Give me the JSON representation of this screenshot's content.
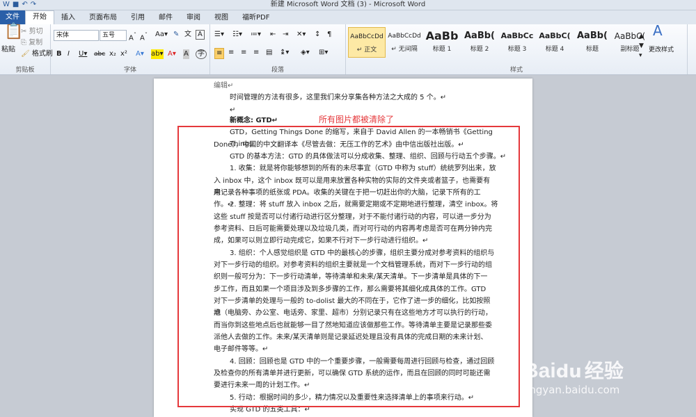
{
  "window": {
    "title": "新建 Microsoft Word 文档 (3)  -  Microsoft Word"
  },
  "tabs": [
    "文件",
    "开始",
    "插入",
    "页面布局",
    "引用",
    "邮件",
    "审阅",
    "视图",
    "福昕PDF"
  ],
  "clipboard": {
    "paste": "粘贴",
    "cut": "剪切",
    "copy": "复制",
    "format_painter": "格式刷",
    "label": "剪贴板"
  },
  "font": {
    "name": "宋体",
    "size": "五号",
    "label": "字体"
  },
  "paragraph": {
    "label": "段落"
  },
  "styles": {
    "label": "样式",
    "items": [
      {
        "sample": "AaBbCcDd",
        "name": "↵ 正文"
      },
      {
        "sample": "AaBbCcDd",
        "name": "↵ 无间隔"
      },
      {
        "sample": "AaBb",
        "name": "标题 1"
      },
      {
        "sample": "AaBb(",
        "name": "标题 2"
      },
      {
        "sample": "AaBbCc",
        "name": "标题 3"
      },
      {
        "sample": "AaBbC(",
        "name": "标题 4"
      },
      {
        "sample": "AaBb(",
        "name": "标题"
      },
      {
        "sample": "AaBbC(",
        "name": "副标题"
      }
    ],
    "change_styles": "更改样式"
  },
  "document": {
    "lines": [
      "编辑↵",
      "时间管理的方法有很多，这里我们来分享集各种方法之大成的 5 个。↵",
      "↵",
      "新概念: GTD↵",
      "GTD，Getting Things Done 的缩写，来自于 David Allen 的一本畅销书《Getting Things",
      "Done》，中国的中文翻译本《尽管去做：无压工作的艺术》由中信出版社出版。↵",
      "GTD 的基本方法：GTD 的具体做法可以分成收集、整理、组织、回顾与行动五个步骤。↵",
      "1. 收集：就是将你能够想到的所有的未尽事宜（GTD 中称为 stuff）统统罗列出来，放",
      "入 inbox 中，这个 inbox 既可以是用来放置各种实物的实际的文件夹或者篮子，也需要有用",
      "来记录各种事项的纸张或 PDA。收集的关键在于把一切赶出你的大脑，记录下所有的工作。↵",
      "2. 整理：将 stuff 放入 inbox 之后，就需要定期或不定期地进行整理，清空 inbox。将",
      "这些 stuff 按是否可以付诸行动进行区分整理，对于不能付诸行动的内容，可以进一步分为",
      "参考资料、日后可能需要处理以及垃圾几类，而对可行动的内容再考虑是否可在两分钟内完",
      "成，如果可以则立即行动完成它，如果不行对下一步行动进行组织。↵",
      "3. 组织：个人感觉组织是 GTD 中的最核心的步骤，组织主要分成对参考资料的组织与",
      "对下一步行动的组织。对参考资料的组织主要就是一个文档管理系统，而对下一步行动的组",
      "织则一般可分为：下一步行动清单，等待清单和未来/某天清单。下一步清单是具体的下一",
      "步工作，而且如果一个项目涉及到多步骤的工作，那么需要将其细化成具体的工作。GTD",
      "对下一步清单的处理与一般的 to-dolist 最大的不同在于，它作了进一步的细化，比如按照地",
      "点（电脑旁、办公室、电话旁、家里、超市）分别记录只有在这些地方才可以执行的行动，",
      "而当你到这些地点后也就能够一目了然地知道应该做那些工作。等待清单主要是记录那些委",
      "派他人去做的工作。未来/某天清单则是记录延迟处理且没有具体的完成日期的未来计划、",
      "电子邮件等等。↵",
      "4. 回顾：回顾也是 GTD 中的一个重要步骤，一般需要每周进行回顾与检查，通过回顾",
      "及检查你的所有清单并进行更新，可以确保 GTD 系统的运作，而且在回顾的同时可能还需",
      "要进行未来一周的计划工作。↵",
      "5. 行动：根据时间的多少，精力情况以及重要性来选择清单上的事项来行动。↵",
      "实现 GTD 的五类工具：↵"
    ]
  },
  "annotation": {
    "text": "所有图片都被清除了",
    "color": "#e5383b"
  },
  "watermark": {
    "logo": "Bai",
    "logo_cn": "经验",
    "url": "jingyan.baidu.com"
  }
}
